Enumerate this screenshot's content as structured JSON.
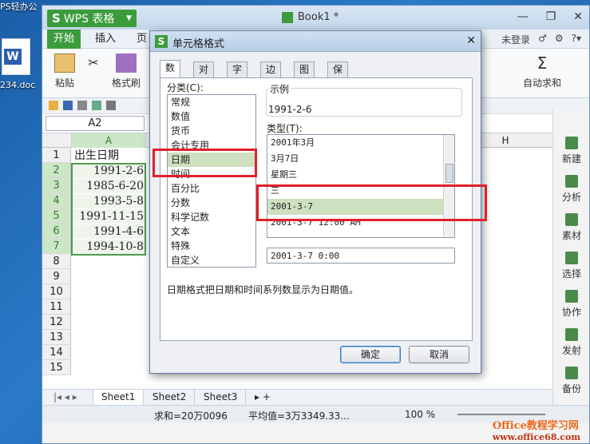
{
  "desktop": {
    "app_title_fragment": "PS轻办公",
    "doc_filename": "234.doc"
  },
  "window": {
    "app_name": "WPS 表格",
    "logo_letter": "S",
    "doc_title": "Book1 *",
    "status_login": "未登录"
  },
  "menu": {
    "tabs": [
      "开始",
      "插入",
      "页"
    ],
    "active": "开始"
  },
  "ribbon": {
    "paste": "粘贴",
    "format_painter": "格式刷",
    "autosum": "自动求和"
  },
  "name_box": "A2",
  "grid": {
    "columns": [
      "A",
      "H"
    ],
    "rows": [
      "1",
      "2",
      "3",
      "4",
      "5",
      "6",
      "7",
      "8",
      "9",
      "10",
      "11",
      "12",
      "13",
      "14",
      "15"
    ],
    "header": "出生日期",
    "values": [
      "1991-2-6",
      "1985-6-20",
      "1993-5-8",
      "1991-11-15",
      "1991-4-6",
      "1994-10-8"
    ]
  },
  "sheets": [
    "Sheet1",
    "Sheet2",
    "Sheet3"
  ],
  "status": {
    "sum": "求和=20万0096",
    "avg": "平均值=3万3349.33...",
    "zoom": "100 %"
  },
  "sidebar": [
    "新建",
    "分析",
    "素材",
    "选择",
    "协作",
    "发射",
    "备份"
  ],
  "dialog": {
    "title": "单元格格式",
    "tabs": [
      "数字",
      "对齐",
      "字体",
      "边框",
      "图案",
      "保护"
    ],
    "active_tab": "数字",
    "category_label": "分类(C):",
    "categories": [
      "常规",
      "数值",
      "货币",
      "会计专用",
      "日期",
      "时间",
      "百分比",
      "分数",
      "科学记数",
      "文本",
      "特殊",
      "自定义"
    ],
    "selected_category": "日期",
    "sample_label": "示例",
    "sample_value": "1991-2-6",
    "type_label": "类型(T):",
    "types": [
      "2001年3月",
      "3月7日",
      "星期三",
      "三",
      "2001-3-7",
      "2001-3-7 12:00 AM",
      "2001-3-7 0:00"
    ],
    "selected_type": "2001-3-7",
    "description": "日期格式把日期和时间系列数显示为日期值。",
    "ok": "确定",
    "cancel": "取消"
  },
  "watermark": {
    "brand": "Office教程学习网",
    "url": "www.office68.com"
  },
  "colors": {
    "accent_green": "#3c9c3c",
    "highlight_red": "#e0202a",
    "selection_bg": "#cde0bf"
  }
}
